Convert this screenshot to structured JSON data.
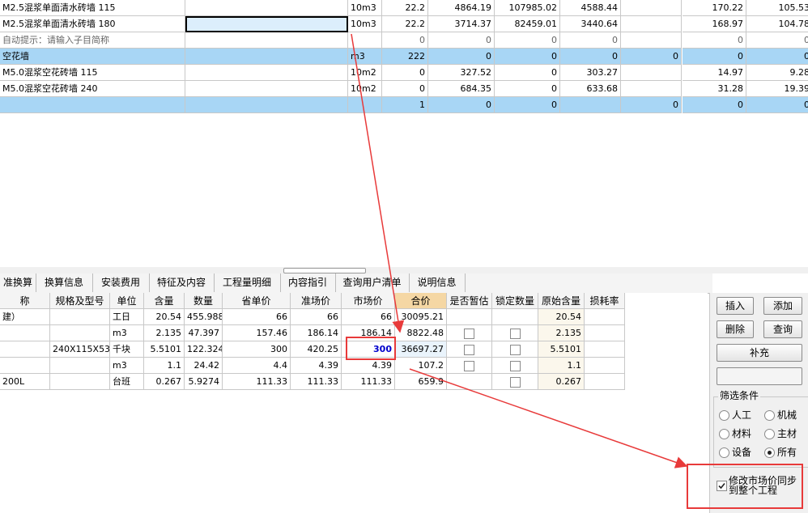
{
  "top_rows": [
    {
      "name": "M2.5混浆单面清水砖墙 115",
      "desc": "",
      "unit": "10m3",
      "qty": "22.2",
      "c1": "4864.19",
      "c2": "107985.02",
      "c3": "4588.44",
      "c4": "",
      "c5": "",
      "c6": "170.22",
      "c7": "105.53",
      "style": ""
    },
    {
      "name": "M2.5混浆单面清水砖墙 180",
      "desc": "",
      "unit": "10m3",
      "qty": "22.2",
      "c1": "3714.37",
      "c2": "82459.01",
      "c3": "3440.64",
      "c4": "",
      "c5": "",
      "c6": "168.97",
      "c7": "104.78",
      "style": "sel"
    },
    {
      "name": "自动提示：请输入子目简称",
      "desc": "",
      "unit": "",
      "qty": "0",
      "c1": "0",
      "c2": "0",
      "c3": "0",
      "c4": "",
      "c5": "",
      "c6": "0",
      "c7": "0",
      "style": "hint"
    },
    {
      "name": "空花墙",
      "desc": "",
      "unit": "m3",
      "qty": "222",
      "c1": "0",
      "c2": "0",
      "c3": "0",
      "c4": "0",
      "c5": "",
      "c6": "0",
      "c7": "0",
      "style": "hl"
    },
    {
      "name": "M5.0混浆空花砖墙 115",
      "desc": "",
      "unit": "10m2",
      "qty": "0",
      "c1": "327.52",
      "c2": "0",
      "c3": "303.27",
      "c4": "",
      "c5": "",
      "c6": "14.97",
      "c7": "9.28",
      "style": ""
    },
    {
      "name": "M5.0混浆空花砖墙 240",
      "desc": "",
      "unit": "10m2",
      "qty": "0",
      "c1": "684.35",
      "c2": "0",
      "c3": "633.68",
      "c4": "",
      "c5": "",
      "c6": "31.28",
      "c7": "19.39",
      "style": ""
    },
    {
      "name": "",
      "desc": "",
      "unit": "",
      "qty": "1",
      "c1": "0",
      "c2": "0",
      "c3": "",
      "c4": "0",
      "c5": "",
      "c6": "0",
      "c7": "0",
      "style": "hl"
    }
  ],
  "tabs": [
    "准换算",
    "换算信息",
    "安装费用",
    "特征及内容",
    "工程量明细",
    "内容指引",
    "查询用户清单",
    "说明信息"
  ],
  "bottom_headers": [
    "称",
    "规格及型号",
    "单位",
    "含量",
    "数量",
    "省单价",
    "准场价",
    "市场价",
    "合价",
    "是否暂估",
    "锁定数量",
    "原始含量",
    "损耗率"
  ],
  "bottom_rows": [
    {
      "name": "建）",
      "spec": "",
      "unit": "工日",
      "content": "20.54",
      "qty": "455.988",
      "prov": "66",
      "base": "66",
      "market": "66",
      "total": "30095.21",
      "est": false,
      "lock": false,
      "orig": "20.54",
      "loss": ""
    },
    {
      "name": "",
      "spec": "",
      "unit": "m3",
      "content": "2.135",
      "qty": "47.397",
      "prov": "157.46",
      "base": "186.14",
      "market": "186.14",
      "total": "8822.48",
      "est": true,
      "lock": true,
      "orig": "2.135",
      "loss": ""
    },
    {
      "name": "",
      "spec": "240X115X53",
      "unit": "千块",
      "content": "5.5101",
      "qty": "122.324",
      "prov": "300",
      "base": "420.25",
      "market": "300",
      "total": "36697.27",
      "est": true,
      "lock": true,
      "orig": "5.5101",
      "loss": ""
    },
    {
      "name": "",
      "spec": "",
      "unit": "m3",
      "content": "1.1",
      "qty": "24.42",
      "prov": "4.4",
      "base": "4.39",
      "market": "4.39",
      "total": "107.2",
      "est": true,
      "lock": true,
      "orig": "1.1",
      "loss": ""
    },
    {
      "name": "200L",
      "spec": "",
      "unit": "台班",
      "content": "0.267",
      "qty": "5.9274",
      "prov": "111.33",
      "base": "111.33",
      "market": "111.33",
      "total": "659.9",
      "est": false,
      "lock": true,
      "orig": "0.267",
      "loss": ""
    }
  ],
  "buttons": {
    "insert": "插入",
    "add": "添加",
    "delete": "删除",
    "query": "查询",
    "supplement": "补充"
  },
  "filter": {
    "title": "筛选条件",
    "labor": "人工",
    "machine": "机械",
    "material": "材料",
    "main_material": "主材",
    "equipment": "设备",
    "all": "所有",
    "selected": "all"
  },
  "sync": {
    "label": "修改市场价同步到整个工程",
    "checked": true
  },
  "colors": {
    "highlight_row": "#a8d6f5",
    "annotation_red": "#e83a3a",
    "edited_price": "#0000cc"
  }
}
